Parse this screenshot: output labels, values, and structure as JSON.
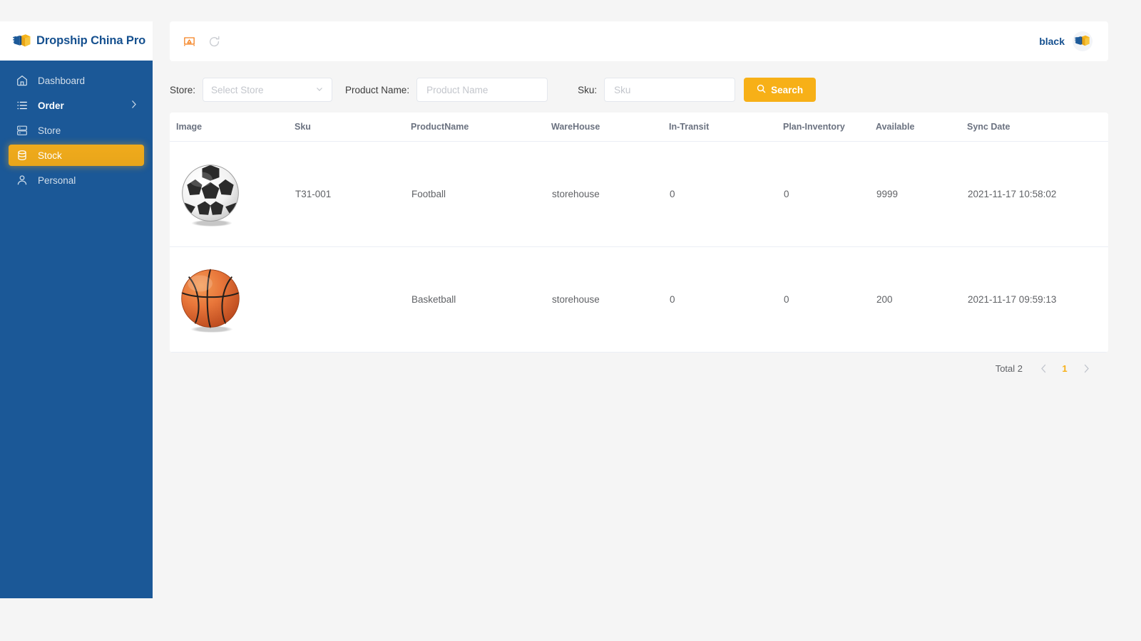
{
  "brand": {
    "title": "Dropship China Pro",
    "logo_icon": "shipping-box-icon"
  },
  "sidebar": {
    "items": [
      {
        "label": "Dashboard",
        "icon": "home-icon",
        "active": false,
        "has_chevron": false
      },
      {
        "label": "Order",
        "icon": "list-icon",
        "active": false,
        "has_chevron": true
      },
      {
        "label": "Store",
        "icon": "server-icon",
        "active": false,
        "has_chevron": false
      },
      {
        "label": "Stock",
        "icon": "database-icon",
        "active": true,
        "has_chevron": false
      },
      {
        "label": "Personal",
        "icon": "user-icon",
        "active": false,
        "has_chevron": false
      }
    ]
  },
  "topbar": {
    "screen_icon": "screen-cast-icon",
    "refresh_icon": "refresh-icon",
    "user_name": "black",
    "avatar_icon": "shipping-box-icon"
  },
  "filters": {
    "store_label": "Store:",
    "store_placeholder": "Select Store",
    "store_value": "",
    "product_name_label": "Product Name:",
    "product_name_placeholder": "Product Name",
    "product_name_value": "",
    "sku_label": "Sku:",
    "sku_placeholder": "Sku",
    "sku_value": "",
    "search_label": "Search",
    "search_icon": "search-icon",
    "dropdown_icon": "chevron-down-icon"
  },
  "table": {
    "columns": [
      "Image",
      "Sku",
      "ProductName",
      "WareHouse",
      "In-Transit",
      "Plan-Inventory",
      "Available",
      "Sync Date"
    ],
    "rows": [
      {
        "image": "football-image",
        "sku": "T31-001",
        "product_name": "Football",
        "warehouse": "storehouse",
        "in_transit": "0",
        "plan_inventory": "0",
        "available": "9999",
        "sync_date": "2021-11-17 10:58:02"
      },
      {
        "image": "basketball-image",
        "sku": "",
        "product_name": "Basketball",
        "warehouse": "storehouse",
        "in_transit": "0",
        "plan_inventory": "0",
        "available": "200",
        "sync_date": "2021-11-17 09:59:13"
      }
    ]
  },
  "pagination": {
    "total_label": "Total 2",
    "prev_icon": "chevron-left-icon",
    "next_icon": "chevron-right-icon",
    "current_page": "1"
  },
  "colors": {
    "sidebar_blue": "#1b5897",
    "accent_yellow": "#f7b017",
    "brand_navy": "#15508f",
    "page_background": "#f5f5f5"
  }
}
